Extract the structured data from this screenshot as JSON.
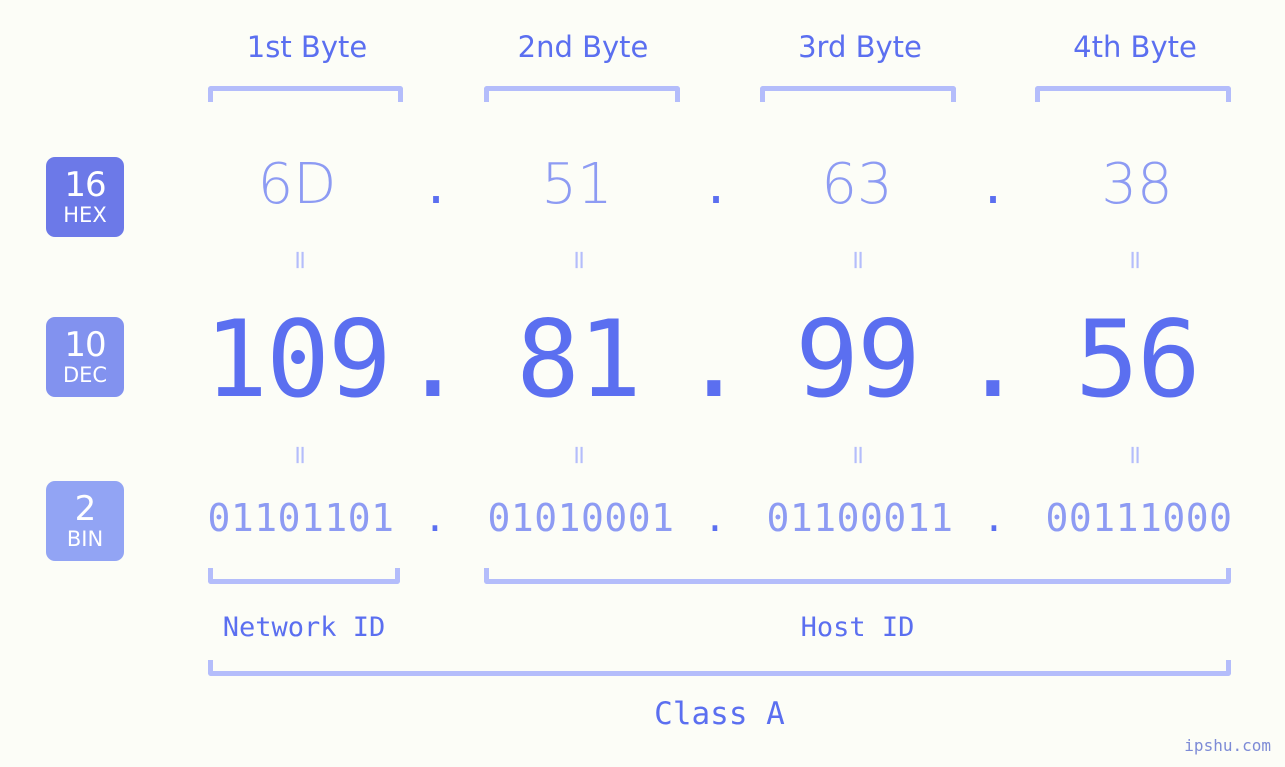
{
  "background_color": "#fcfdf7",
  "accent_color": "#5b6ff0",
  "accent_light": "#8d9bf3",
  "bracket_color": "#b4bdfb",
  "byte_headers": [
    {
      "label": "1st Byte"
    },
    {
      "label": "2nd Byte"
    },
    {
      "label": "3rd Byte"
    },
    {
      "label": "4th Byte"
    }
  ],
  "rows": [
    {
      "base": "16",
      "system": "HEX",
      "badge_color": "#6c79e8",
      "values": [
        "6D",
        "51",
        "63",
        "38"
      ],
      "separator": "."
    },
    {
      "base": "10",
      "system": "DEC",
      "badge_color": "#8292ef",
      "values": [
        "109",
        "81",
        "99",
        "56"
      ],
      "separator": "."
    },
    {
      "base": "2",
      "system": "BIN",
      "badge_color": "#92a4f4",
      "values": [
        "01101101",
        "01010001",
        "01100011",
        "00111000"
      ],
      "separator": "."
    }
  ],
  "equals_sign": "=",
  "segments": {
    "network_id": "Network ID",
    "host_id": "Host ID"
  },
  "ip_class": "Class A",
  "watermark": "ipshu.com"
}
